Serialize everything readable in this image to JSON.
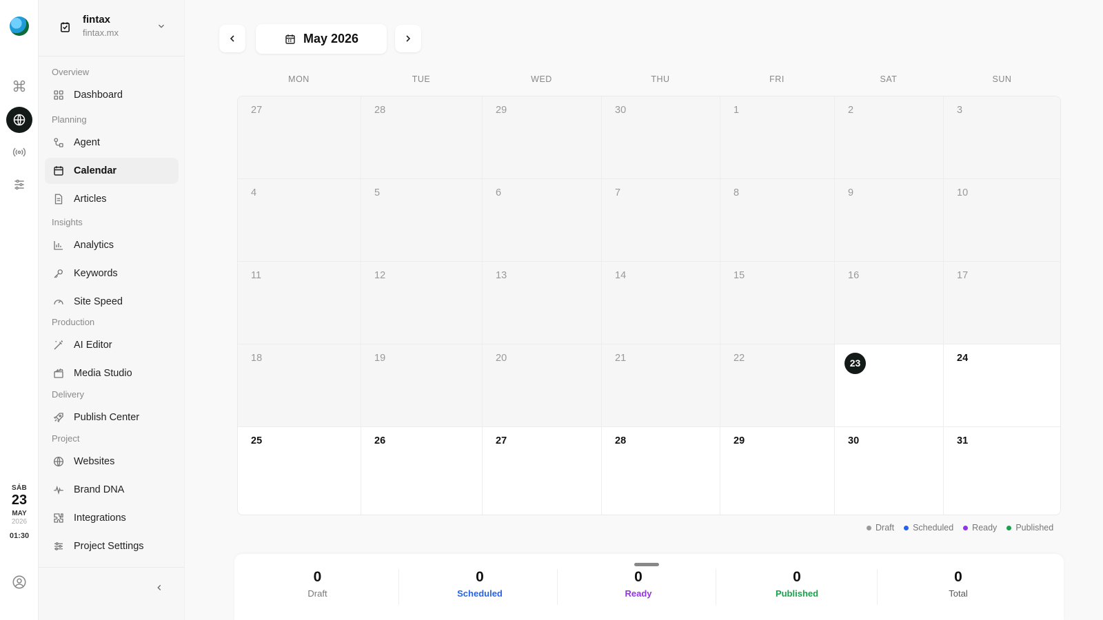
{
  "rail": {
    "date": {
      "dow": "SÁB",
      "day": "23",
      "month": "MAY",
      "year": "2026",
      "time": "01:30"
    }
  },
  "workspace": {
    "name": "fintax",
    "domain": "fintax.mx"
  },
  "sidebar": {
    "sections": {
      "overview": "Overview",
      "planning": "Planning",
      "insights": "Insights",
      "production": "Production",
      "delivery": "Delivery",
      "project": "Project"
    },
    "items": {
      "dashboard": "Dashboard",
      "agent": "Agent",
      "calendar": "Calendar",
      "articles": "Articles",
      "analytics": "Analytics",
      "keywords": "Keywords",
      "site_speed": "Site Speed",
      "ai_editor": "AI Editor",
      "media_studio": "Media Studio",
      "publish_center": "Publish Center",
      "websites": "Websites",
      "brand_dna": "Brand DNA",
      "integrations": "Integrations",
      "project_settings": "Project Settings"
    },
    "active": "calendar"
  },
  "calendar": {
    "month_label": "May 2026",
    "weekdays": [
      "MON",
      "TUE",
      "WED",
      "THU",
      "FRI",
      "SAT",
      "SUN"
    ],
    "weeks": [
      [
        {
          "n": "27",
          "s": "dim"
        },
        {
          "n": "28",
          "s": "dim"
        },
        {
          "n": "29",
          "s": "dim"
        },
        {
          "n": "30",
          "s": "dim"
        },
        {
          "n": "1",
          "s": "dim"
        },
        {
          "n": "2",
          "s": "dim"
        },
        {
          "n": "3",
          "s": "dim"
        }
      ],
      [
        {
          "n": "4",
          "s": "dim"
        },
        {
          "n": "5",
          "s": "dim"
        },
        {
          "n": "6",
          "s": "dim"
        },
        {
          "n": "7",
          "s": "dim"
        },
        {
          "n": "8",
          "s": "dim"
        },
        {
          "n": "9",
          "s": "dim"
        },
        {
          "n": "10",
          "s": "dim"
        }
      ],
      [
        {
          "n": "11",
          "s": "dim"
        },
        {
          "n": "12",
          "s": "dim"
        },
        {
          "n": "13",
          "s": "dim"
        },
        {
          "n": "14",
          "s": "dim"
        },
        {
          "n": "15",
          "s": "dim"
        },
        {
          "n": "16",
          "s": "dim"
        },
        {
          "n": "17",
          "s": "dim"
        }
      ],
      [
        {
          "n": "18",
          "s": "dim"
        },
        {
          "n": "19",
          "s": "dim"
        },
        {
          "n": "20",
          "s": "dim"
        },
        {
          "n": "21",
          "s": "dim"
        },
        {
          "n": "22",
          "s": "dim"
        },
        {
          "n": "23",
          "s": "today"
        },
        {
          "n": "24",
          "s": "cur"
        }
      ],
      [
        {
          "n": "25",
          "s": "cur"
        },
        {
          "n": "26",
          "s": "cur"
        },
        {
          "n": "27",
          "s": "cur"
        },
        {
          "n": "28",
          "s": "cur"
        },
        {
          "n": "29",
          "s": "cur"
        },
        {
          "n": "30",
          "s": "cur"
        },
        {
          "n": "31",
          "s": "cur"
        }
      ]
    ]
  },
  "legend": [
    {
      "label": "Draft",
      "color": "#9a9a9a"
    },
    {
      "label": "Scheduled",
      "color": "#2563eb"
    },
    {
      "label": "Ready",
      "color": "#9333ea"
    },
    {
      "label": "Published",
      "color": "#16a34a"
    }
  ],
  "stats": [
    {
      "value": "0",
      "label": "Draft",
      "color": "#777777"
    },
    {
      "value": "0",
      "label": "Scheduled",
      "color": "#2563eb"
    },
    {
      "value": "0",
      "label": "Ready",
      "color": "#9333ea"
    },
    {
      "value": "0",
      "label": "Published",
      "color": "#16a34a"
    },
    {
      "value": "0",
      "label": "Total",
      "color": "#555555"
    }
  ]
}
